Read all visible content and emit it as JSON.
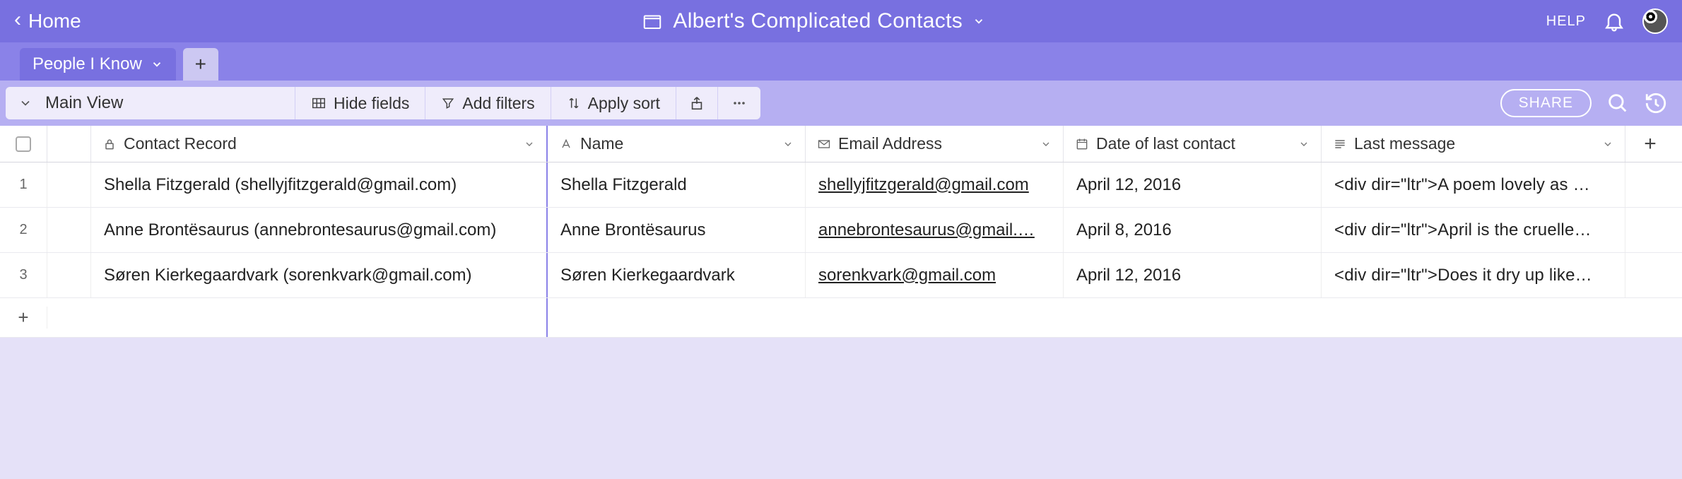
{
  "nav": {
    "home": "Home",
    "base_name": "Albert's Complicated Contacts",
    "help": "HELP"
  },
  "tabs": {
    "active": "People I Know"
  },
  "toolbar": {
    "view_name": "Main View",
    "hide_fields": "Hide fields",
    "add_filters": "Add filters",
    "apply_sort": "Apply sort",
    "share": "SHARE"
  },
  "columns": [
    {
      "label": "Contact Record"
    },
    {
      "label": "Name"
    },
    {
      "label": "Email Address"
    },
    {
      "label": "Date of last contact"
    },
    {
      "label": "Last message"
    }
  ],
  "rows": [
    {
      "n": "1",
      "record": "Shella Fitzgerald (shellyjfitzgerald@gmail.com)",
      "name": "Shella Fitzgerald",
      "email": "shellyjfitzgerald@gmail.com",
      "date": "April 12, 2016",
      "msg": "<div dir=\"ltr\">A poem lovely as …"
    },
    {
      "n": "2",
      "record": "Anne Brontësaurus (annebrontesaurus@gmail.com)",
      "name": "Anne Brontësaurus",
      "email": "annebrontesaurus@gmail.…",
      "date": "April 8, 2016",
      "msg": "<div dir=\"ltr\">April is the cruelle…"
    },
    {
      "n": "3",
      "record": "Søren Kierkegaardvark (sorenkvark@gmail.com)",
      "name": "Søren Kierkegaardvark",
      "email": "sorenkvark@gmail.com",
      "date": "April 12, 2016",
      "msg": "<div dir=\"ltr\">Does it dry up like…"
    }
  ]
}
